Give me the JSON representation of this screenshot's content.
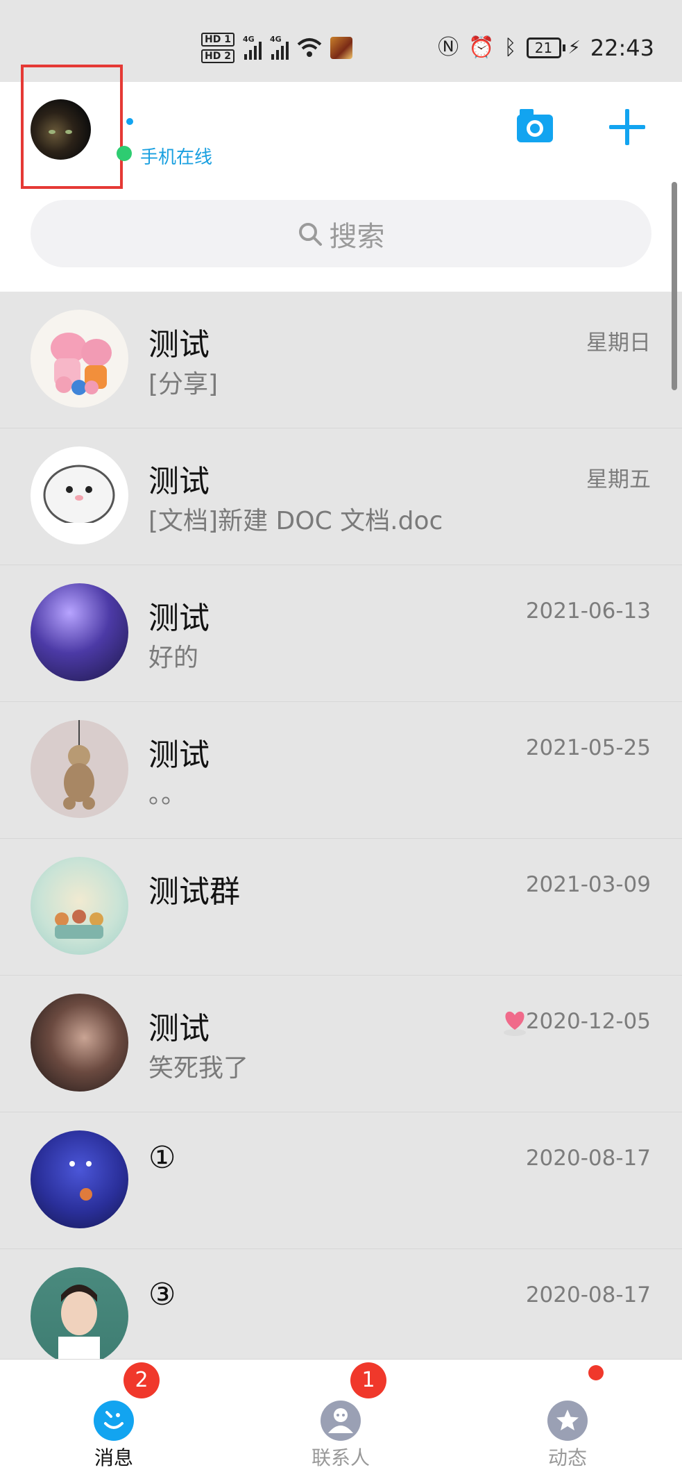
{
  "status_bar": {
    "sim1": "HD 1",
    "sim2": "HD 2",
    "network1": "4G",
    "network2": "4G",
    "battery": "21",
    "time": "22:43"
  },
  "header": {
    "online_status": "手机在线",
    "search_placeholder": "搜索"
  },
  "chats": [
    {
      "name": "测试",
      "preview": "[分享]",
      "time": "星期日"
    },
    {
      "name": "测试",
      "preview": "[文档]新建 DOC 文档.doc",
      "time": "星期五"
    },
    {
      "name": "测试",
      "preview": "好的",
      "time": "2021-06-13"
    },
    {
      "name": "测试",
      "preview": "。。",
      "time": "2021-05-25"
    },
    {
      "name": "测试群",
      "preview": "",
      "time": "2021-03-09"
    },
    {
      "name": "测试",
      "preview": "笑死我了",
      "time": "2020-12-05"
    },
    {
      "name": "①",
      "preview": "",
      "time": "2020-08-17"
    },
    {
      "name": "③",
      "preview": "",
      "time": "2020-08-17"
    }
  ],
  "bottom_nav": {
    "messages": {
      "label": "消息",
      "badge": "2"
    },
    "contacts": {
      "label": "联系人",
      "badge": "1"
    },
    "moments": {
      "label": "动态"
    }
  },
  "colors": {
    "accent": "#12a4f0",
    "badge": "#f0382b",
    "online": "#2ecc71",
    "highlight_box": "#e53935"
  }
}
